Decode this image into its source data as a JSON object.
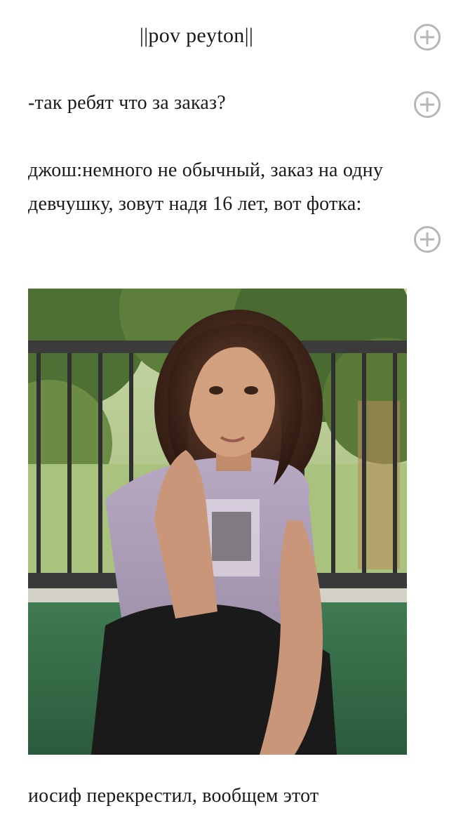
{
  "story": {
    "heading": "||pov peyton||",
    "paragraphs": [
      "-так ребят что за заказ?",
      "джош:немного не обычный, заказ на одну девчушку, зовут надя 16 лет, вот фотка:",
      "иосиф перекрестил, вообщем этот"
    ]
  },
  "icons": {
    "add_comment": "plus-circle-icon"
  },
  "colors": {
    "text": "#1a1a1a",
    "icon": "#b6b6b6",
    "background": "#ffffff"
  }
}
